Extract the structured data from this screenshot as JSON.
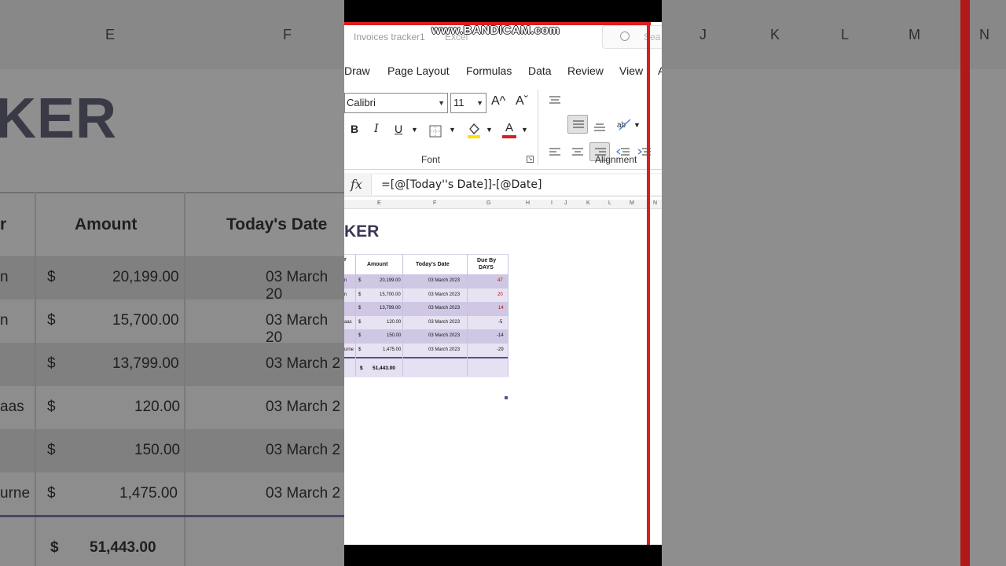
{
  "background": {
    "column_letters_left": [
      "E",
      "F"
    ],
    "column_letters_right": [
      "J",
      "K",
      "L",
      "M",
      "N"
    ],
    "title_fragment": "KER",
    "header": {
      "col0": "r",
      "col1": "Amount",
      "col2": "Today's Date"
    },
    "rows": [
      {
        "name": "n",
        "currency": "$",
        "amount": "20,199.00",
        "date": "03 March 20"
      },
      {
        "name": "n",
        "currency": "$",
        "amount": "15,700.00",
        "date": "03 March 20"
      },
      {
        "name": "",
        "currency": "$",
        "amount": "13,799.00",
        "date": "03 March 2"
      },
      {
        "name": "aas",
        "currency": "$",
        "amount": "120.00",
        "date": "03 March 2"
      },
      {
        "name": "",
        "currency": "$",
        "amount": "150.00",
        "date": "03 March 2"
      },
      {
        "name": "urne",
        "currency": "$",
        "amount": "1,475.00",
        "date": "03 March 2"
      }
    ],
    "total": {
      "currency": "$",
      "amount": "51,443.00"
    }
  },
  "capture": {
    "watermark": "www.BANDICAM.com",
    "window_title": "Invoices tracker1",
    "window_app": "Excel",
    "search_placeholder": "Sea",
    "menu": [
      "Draw",
      "Page Layout",
      "Formulas",
      "Data",
      "Review",
      "View",
      "A"
    ],
    "ribbon": {
      "font_name": "Calibri",
      "font_size": "11",
      "grow_font": "A^",
      "shrink_font": "Aˇ",
      "bold": "B",
      "italic": "I",
      "underline": "U",
      "font_group_label": "Font",
      "alignment_group_label": "Alignment",
      "colors": {
        "highlight": "#ffe000",
        "font_color": "#d81e1e"
      }
    },
    "formula": "=[@[Today''s Date]]-[@Date]",
    "fx": "fx",
    "column_letters": [
      "E",
      "F",
      "G",
      "H",
      "I",
      "J",
      "K",
      "L",
      "M",
      "N"
    ],
    "sheet_title": "KER",
    "table": {
      "headers": {
        "c0": "r",
        "amount": "Amount",
        "today": "Today's Date",
        "due1": "Due By",
        "due2": "DAYS"
      },
      "rows": [
        {
          "name": "n",
          "currency": "$",
          "amount": "20,199.00",
          "date": "03 March 2023",
          "days": "47",
          "overdue": true
        },
        {
          "name": "n",
          "currency": "$",
          "amount": "15,700.00",
          "date": "03 March 2023",
          "days": "20",
          "overdue": true
        },
        {
          "name": "",
          "currency": "$",
          "amount": "13,799.00",
          "date": "03 March 2023",
          "days": "14",
          "overdue": true
        },
        {
          "name": "aas",
          "currency": "$",
          "amount": "120.00",
          "date": "03 March 2023",
          "days": "-5",
          "overdue": false
        },
        {
          "name": "",
          "currency": "$",
          "amount": "150.00",
          "date": "03 March 2023",
          "days": "-14",
          "overdue": false
        },
        {
          "name": "urne",
          "currency": "$",
          "amount": "1,475.00",
          "date": "03 March 2023",
          "days": "-29",
          "overdue": false
        }
      ],
      "total": {
        "currency": "$",
        "amount": "51,443.00"
      }
    },
    "accent_red": "#d81e1e",
    "table_colors": {
      "dark_row": "#cfc7e4",
      "light_row": "#e8e3f3",
      "total_line": "#5b4f8a"
    }
  }
}
